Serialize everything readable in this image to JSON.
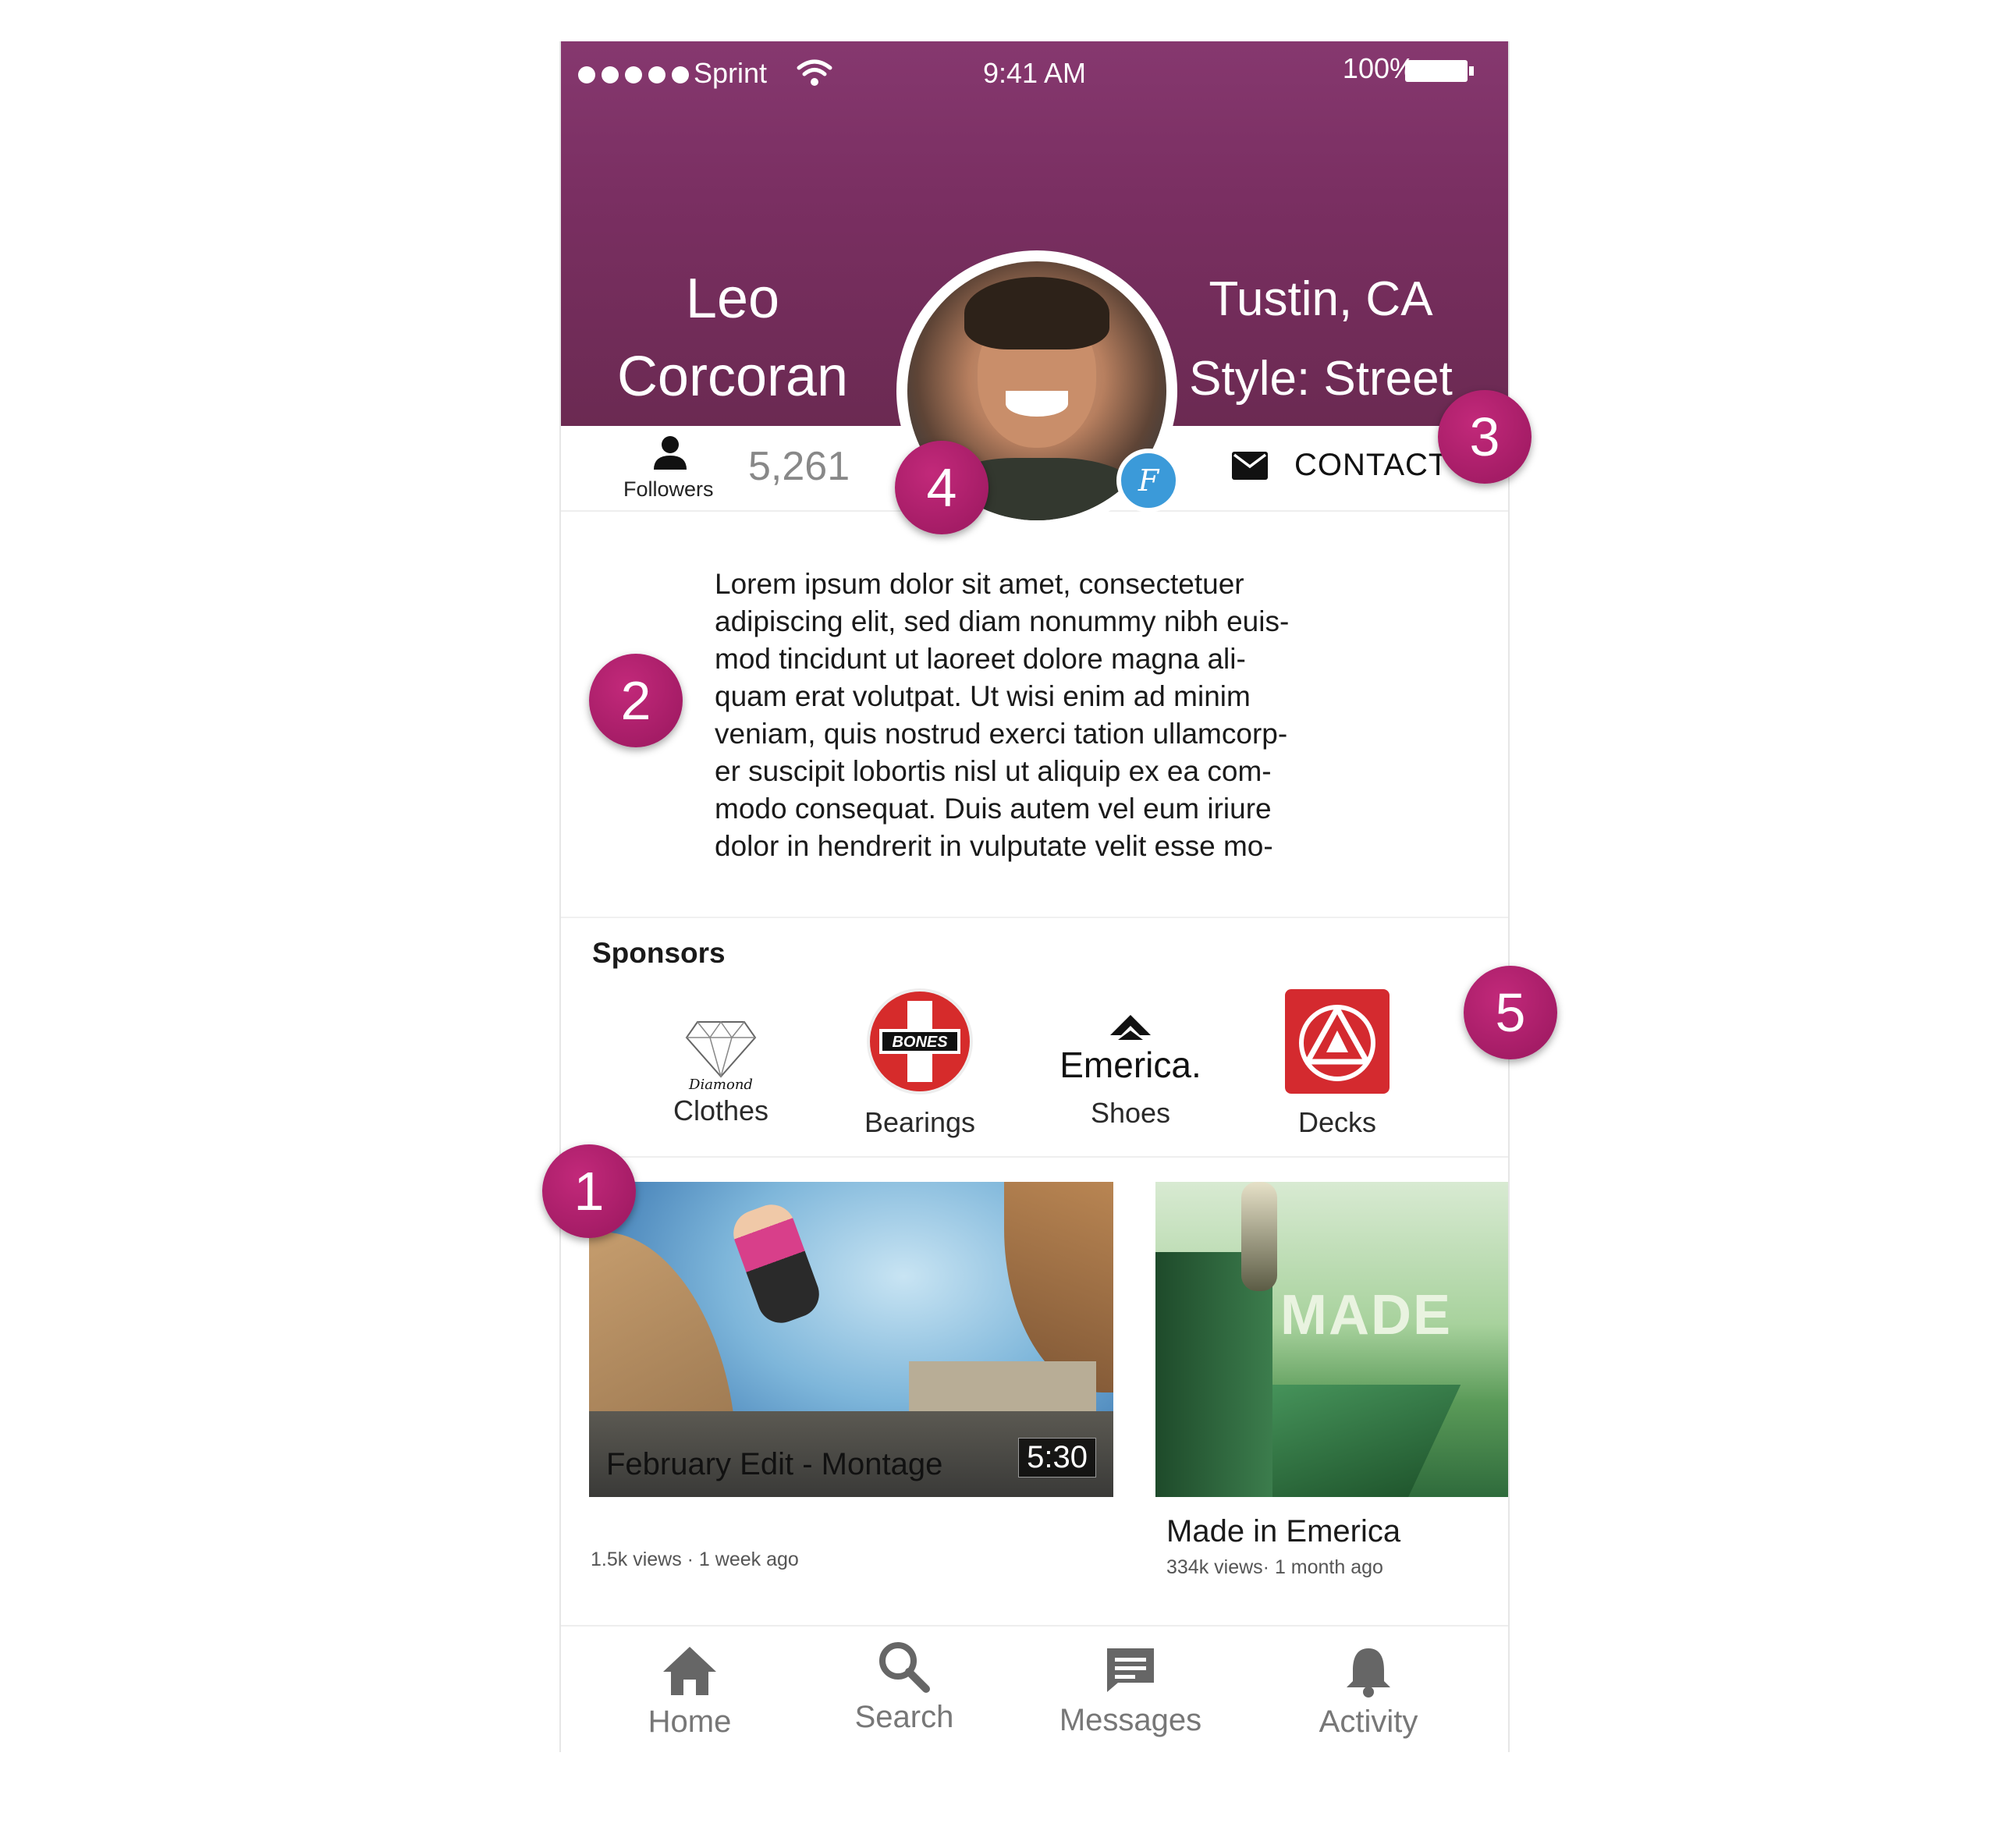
{
  "status_bar": {
    "carrier": "Sprint",
    "time": "9:41 AM",
    "battery": "100%"
  },
  "profile": {
    "first_name": "Leo",
    "last_name": "Corcoran",
    "location": "Tustin, CA",
    "style": "Style: Street",
    "verified_badge_letter": "F"
  },
  "stats": {
    "followers_label": "Followers",
    "followers_count": "5,261",
    "contact_label": "CONTACT"
  },
  "bio": "Lorem ipsum dolor sit amet, consectetuer\nadipiscing elit, sed diam nonummy nibh euis-\nmod tincidunt ut laoreet dolore magna ali-\nquam erat volutpat. Ut wisi enim ad minim\nveniam, quis nostrud exerci tation ullamcorp-\ner suscipit lobortis nisl ut aliquip ex ea com-\nmodo consequat. Duis autem vel eum iriure\ndolor in hendrerit in vulputate velit esse mo-",
  "sponsors": {
    "title": "Sponsors",
    "items": [
      {
        "label": "Clothes",
        "logo_text": "Diamond",
        "icon": "diamond-icon"
      },
      {
        "label": "Bearings",
        "logo_text": "BONES",
        "icon": "bones-logo"
      },
      {
        "label": "Shoes",
        "logo_text": "Emerica.",
        "icon": "emerica-logo"
      },
      {
        "label": "Decks",
        "logo_text": "",
        "icon": "decks-logo"
      }
    ]
  },
  "videos": [
    {
      "title": "February Edit - Montage",
      "duration": "5:30",
      "meta": "1.5k views · 1 week ago"
    },
    {
      "title": "Made in Emerica",
      "thumb_text": "MADE",
      "meta": "334k views· 1 month ago"
    }
  ],
  "tabs": [
    {
      "label": "Home",
      "icon": "home-icon"
    },
    {
      "label": "Search",
      "icon": "search-icon"
    },
    {
      "label": "Messages",
      "icon": "message-icon"
    },
    {
      "label": "Activity",
      "icon": "bell-icon"
    }
  ],
  "markers": [
    "1",
    "2",
    "3",
    "4",
    "5"
  ],
  "colors": {
    "header": "#7a2f62",
    "marker": "#b02070",
    "badge": "#3b9ad9",
    "decks_red": "#d42a2f",
    "bones_red": "#d62b2b"
  }
}
